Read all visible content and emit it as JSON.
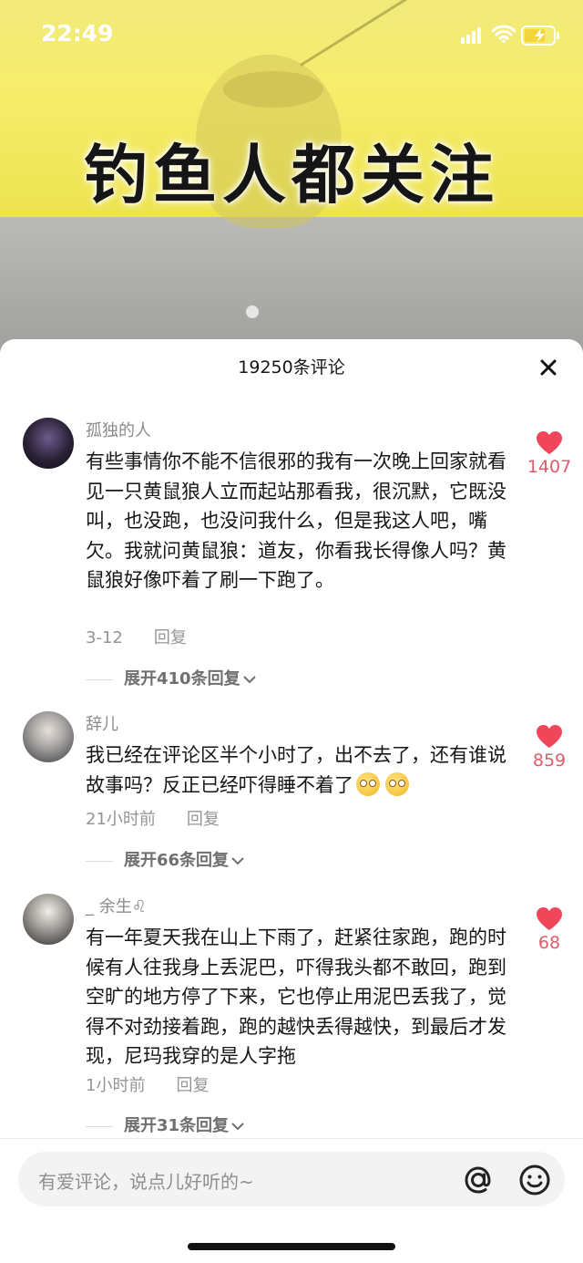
{
  "status_bar": {
    "time": "22:49"
  },
  "video": {
    "title": "钓鱼人都关注"
  },
  "sheet": {
    "title": "19250条评论"
  },
  "comments": [
    {
      "author": "孤独的人",
      "text": "有些事情你不能不信很邪的我有一次晚上回家就看见一只黄鼠狼人立而起站那看我，很沉默，它既没叫，也没跑，也没问我什么，但是我这人吧，嘴欠。我就问黄鼠狼：道友，你看我长得像人吗？黄鼠狼好像吓着了刷一下跑了。",
      "date": "3-12",
      "reply": "回复",
      "expand": "展开410条回复",
      "likes": "1407"
    },
    {
      "author": "辞儿",
      "text": "我已经在评论区半个小时了，出不去了，还有谁说故事吗？反正已经吓得睡不着了",
      "date": "21小时前",
      "reply": "回复",
      "expand": "展开66条回复",
      "likes": "859"
    },
    {
      "author": "_ 余生♌",
      "text": "有一年夏天我在山上下雨了，赶紧往家跑，跑的时候有人往我身上丢泥巴，吓得我头都不敢回，跑到空旷的地方停了下来，它也停止用泥巴丢我了，觉得不对劲接着跑，跑的越快丢得越快，到最后才发现，尼玛我穿的是人字拖",
      "date": "1小时前",
      "reply": "回复",
      "expand": "展开31条回复",
      "likes": "68"
    }
  ],
  "input": {
    "placeholder": "有爱评论，说点儿好听的~"
  },
  "colors": {
    "like": "#f0465a",
    "banner": "#f3eb6a"
  }
}
